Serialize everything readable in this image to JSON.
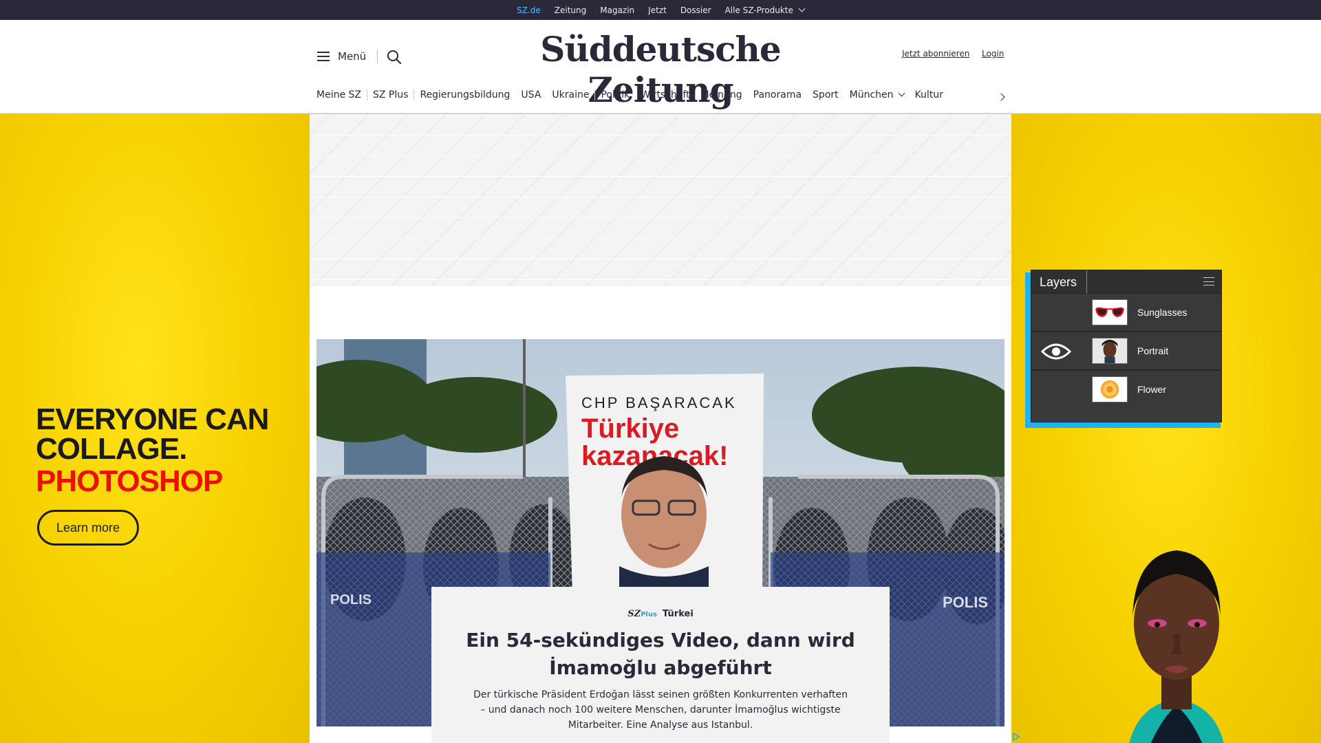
{
  "topbar": {
    "links": [
      {
        "label": "SZ.de"
      },
      {
        "label": "Zeitung"
      },
      {
        "label": "Magazin"
      },
      {
        "label": "Jetzt"
      },
      {
        "label": "Dossier"
      },
      {
        "label": "Alle SZ-Produkte"
      }
    ]
  },
  "header": {
    "menu_label": "Menü",
    "logo": "Süddeutsche Zeitung",
    "subscribe_label": "Jetzt abonnieren",
    "login_label": "Login"
  },
  "ressorts": [
    {
      "label": "Meine SZ"
    },
    {
      "label": "SZ Plus"
    },
    {
      "label": "Regierungsbildung"
    },
    {
      "label": "USA"
    },
    {
      "label": "Ukraine"
    },
    {
      "label": "Politik"
    },
    {
      "label": "Wirtschaft"
    },
    {
      "label": "Meinung"
    },
    {
      "label": "Panorama"
    },
    {
      "label": "Sport"
    },
    {
      "label": "München"
    },
    {
      "label": "Kultur"
    }
  ],
  "ad_left": {
    "line1": "EVERYONE CAN",
    "line2": "COLLAGE.",
    "line3": "PHOTOSHOP",
    "cta": "Learn more"
  },
  "ad_right": {
    "panel_title": "Layers",
    "layers": [
      {
        "name": "Sunglasses",
        "visible": false,
        "icon": "sunglasses-thumbnail"
      },
      {
        "name": "Portrait",
        "visible": true,
        "icon": "portrait-thumbnail"
      },
      {
        "name": "Flower",
        "visible": false,
        "icon": "flower-thumbnail"
      }
    ]
  },
  "hero": {
    "sign_top": "CHP BAŞARACAK",
    "sign_line1": "Türkiye",
    "sign_line2": "kazanacak!",
    "barrier_text_left": "POLIS",
    "barrier_text_right": "POLIS"
  },
  "teaser": {
    "brand_sz": "SZ",
    "brand_plus": "Plus",
    "kicker": "Türkei",
    "headline": "Ein 54-sekündiges Video, dann wird İmamoğlu abgeführt",
    "summary": "Der türkische Präsident Erdoğan lässt seinen größten Konkurrenten verhaften – und danach noch 100 weitere Menschen, darunter İmamoğlus wichtigste Mitarbeiter. Eine Analyse aus Istanbul."
  },
  "colors": {
    "brand_dark": "#29293a",
    "ad_yellow": "#f6d000",
    "photoshop_red": "#eb1000",
    "szplus_teal": "#2aa9b7",
    "link_active": "#58b9ff",
    "layers_border": "#1fb2f0"
  },
  "icons": [
    "menu-icon",
    "search-icon",
    "chevron-down-icon",
    "chevron-right-icon",
    "eye-icon",
    "panel-menu-icon",
    "adchoices-icon"
  ]
}
